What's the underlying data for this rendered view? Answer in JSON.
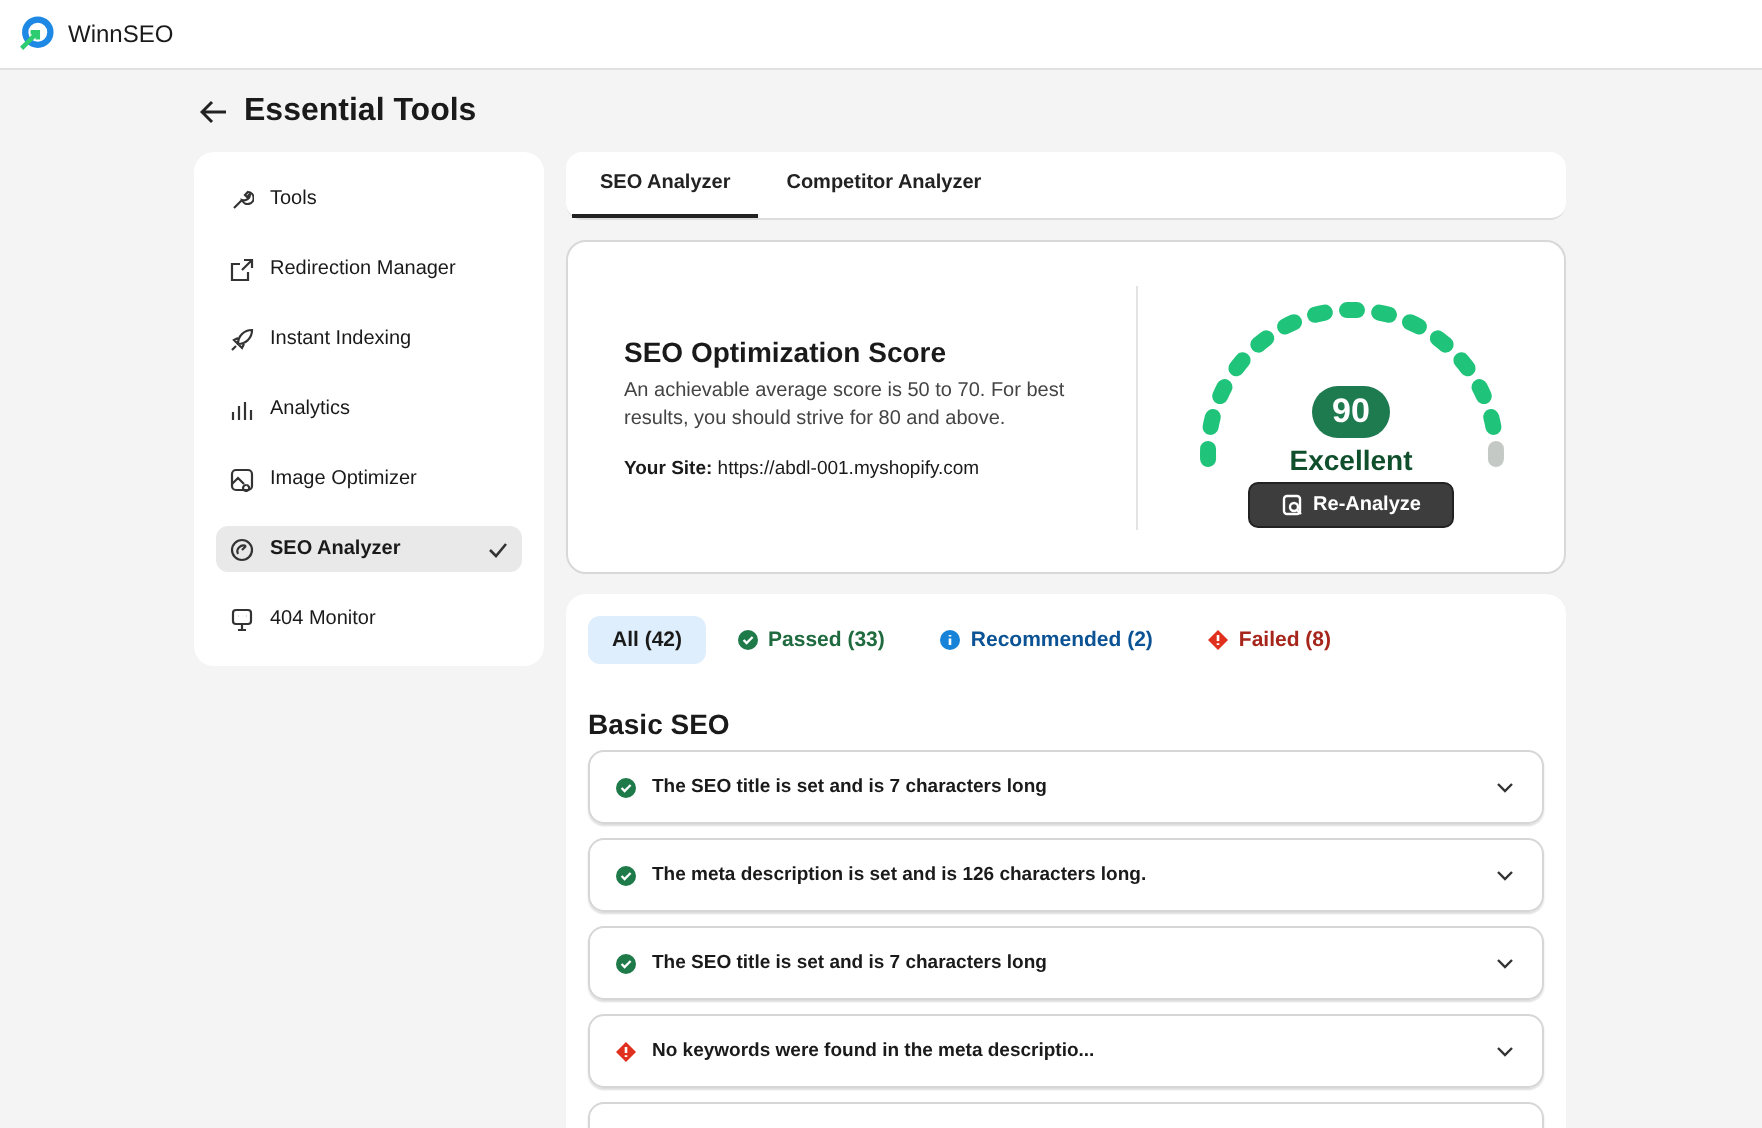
{
  "app": {
    "name": "WinnSEO"
  },
  "page_title": "Essential Tools",
  "sidebar": {
    "items": [
      {
        "label": "Tools",
        "selected": false
      },
      {
        "label": "Redirection Manager",
        "selected": false
      },
      {
        "label": "Instant Indexing",
        "selected": false
      },
      {
        "label": "Analytics",
        "selected": false
      },
      {
        "label": "Image Optimizer",
        "selected": false
      },
      {
        "label": "SEO Analyzer",
        "selected": true
      },
      {
        "label": "404 Monitor",
        "selected": false
      }
    ]
  },
  "tabs": [
    {
      "label": "SEO Analyzer",
      "selected": true
    },
    {
      "label": "Competitor Analyzer",
      "selected": false
    }
  ],
  "score": {
    "title": "SEO Optimization Score",
    "description": "An achievable average score is 50 to 70. For best results, you should strive for 80 and above.",
    "site_label": "Your Site:",
    "site_url": "https://abdl-001.myshopify.com",
    "value": "90",
    "level": 0.9,
    "rating": "Excellent",
    "button": "Re-Analyze"
  },
  "filters": [
    {
      "label": "All (42)",
      "kind": "all",
      "selected": true
    },
    {
      "label": "Passed (33)",
      "kind": "passed",
      "selected": false
    },
    {
      "label": "Recommended (2)",
      "kind": "recommended",
      "selected": false
    },
    {
      "label": "Failed (8)",
      "kind": "failed",
      "selected": false
    }
  ],
  "section_title": "Basic SEO",
  "checks": [
    {
      "text": "The SEO title is set and is 7 characters long",
      "kind": "passed"
    },
    {
      "text": "The meta description is set and is 126 characters long.",
      "kind": "passed"
    },
    {
      "text": "The SEO title is set and is 7 characters long",
      "kind": "passed"
    },
    {
      "text": "No keywords were found in the meta descriptio...",
      "kind": "failed"
    },
    {
      "kind": "partial"
    }
  ]
}
